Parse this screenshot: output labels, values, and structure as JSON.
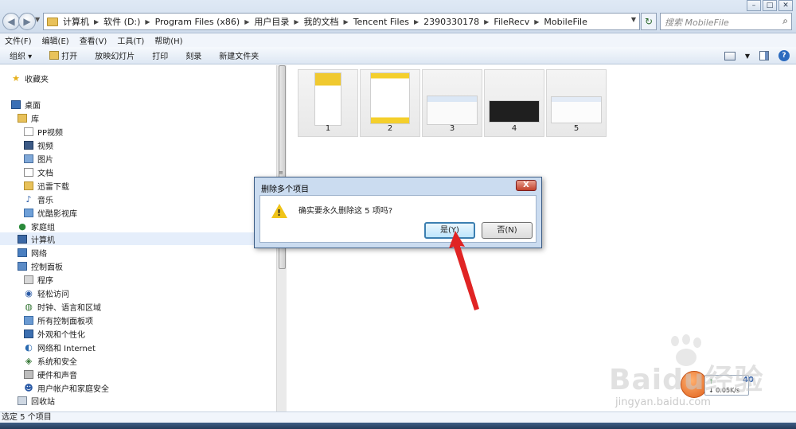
{
  "address_bar": {
    "breadcrumbs": [
      "计算机",
      "软件 (D:)",
      "Program Files (x86)",
      "用户目录",
      "我的文档",
      "Tencent Files",
      "2390330178",
      "FileRecv",
      "MobileFile"
    ],
    "search_placeholder": "搜索 MobileFile"
  },
  "menu": [
    "文件(F)",
    "编辑(E)",
    "查看(V)",
    "工具(T)",
    "帮助(H)"
  ],
  "toolbar": {
    "organize": "组织 ▾",
    "open": "打开",
    "slideshow": "放映幻灯片",
    "print": "打印",
    "burn": "刻录",
    "new_folder": "新建文件夹"
  },
  "nav": {
    "favorites": "收藏夹",
    "desktop": "桌面",
    "libraries": "库",
    "pp_video": "PP视频",
    "videos": "视频",
    "pictures": "图片",
    "documents": "文档",
    "xunlei": "迅雷下载",
    "music": "音乐",
    "youku": "优酷影视库",
    "homegroup": "家庭组",
    "computer": "计算机",
    "network": "网络",
    "control_panel": "控制面板",
    "programs": "程序",
    "ease_access": "轻松访问",
    "clock_region": "时钟、语言和区域",
    "all_cp_items": "所有控制面板项",
    "appearance": "外观和个性化",
    "net_internet": "网络和 Internet",
    "system_security": "系统和安全",
    "hardware_sound": "硬件和声音",
    "user_accounts": "用户帐户和家庭安全",
    "recycle_bin": "回收站"
  },
  "files": [
    {
      "label": "1"
    },
    {
      "label": "2"
    },
    {
      "label": "3"
    },
    {
      "label": "4"
    },
    {
      "label": "5"
    }
  ],
  "dialog": {
    "title": "删除多个项目",
    "message": "确实要永久删除这 5 项吗?",
    "yes": "是(Y)",
    "no": "否(N)",
    "close": "X"
  },
  "status": "选定 5 个项目",
  "speed_widget": {
    "rate": "0.05K/s",
    "num": "40"
  },
  "watermark": {
    "main": "Baidu经验",
    "sub": "jingyan.baidu.com"
  }
}
